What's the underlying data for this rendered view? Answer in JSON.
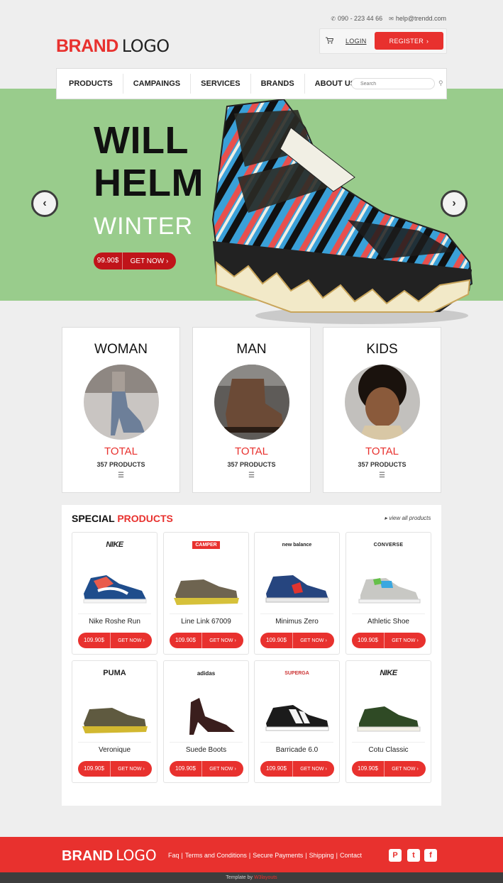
{
  "header": {
    "phone": "090 - 223 44 66",
    "email": "help@trendd.com",
    "logo_bold": "BRAND",
    "logo_light": "LOGO",
    "login": "LOGIN",
    "register": "REGISTER"
  },
  "nav": {
    "items": [
      "PRODUCTS",
      "CAMPAINGS",
      "SERVICES",
      "BRANDS",
      "ABOUT US"
    ],
    "search_placeholder": "Search"
  },
  "hero": {
    "title_line1": "WILL",
    "title_line2": "HELM",
    "subtitle": "WINTER",
    "price": "99.90$",
    "cta": "GET NOW",
    "prev_icon": "chevron-left-icon",
    "next_icon": "chevron-right-icon"
  },
  "categories": [
    {
      "title": "WOMAN",
      "total": "TOTAL",
      "count": "357 PRODUCTS"
    },
    {
      "title": "MAN",
      "total": "TOTAL",
      "count": "357 PRODUCTS"
    },
    {
      "title": "KIDS",
      "total": "TOTAL",
      "count": "357 PRODUCTS"
    }
  ],
  "special": {
    "title_black": "SPECIAL",
    "title_red": "PRODUCTS",
    "view_all": "view all products",
    "products": [
      {
        "brand": "NIKE",
        "name": "Nike Roshe Run",
        "price": "109.90$",
        "cta": "GET NOW"
      },
      {
        "brand": "CAMPER",
        "name": "Line Link 67009",
        "price": "109.90$",
        "cta": "GET NOW"
      },
      {
        "brand": "new balance",
        "name": "Minimus Zero",
        "price": "109.90$",
        "cta": "GET NOW"
      },
      {
        "brand": "CONVERSE",
        "name": "Athletic Shoe",
        "price": "109.90$",
        "cta": "GET NOW"
      },
      {
        "brand": "PUMA",
        "name": "Veronique",
        "price": "109.90$",
        "cta": "GET NOW"
      },
      {
        "brand": "adidas",
        "name": "Suede Boots",
        "price": "109.90$",
        "cta": "GET NOW"
      },
      {
        "brand": "SUPERGA",
        "name": "Barricade 6.0",
        "price": "109.90$",
        "cta": "GET NOW"
      },
      {
        "brand": "NIKE",
        "name": "Cotu Classic",
        "price": "109.90$",
        "cta": "GET NOW"
      }
    ]
  },
  "footer": {
    "logo_bold": "BRAND",
    "logo_light": "LOGO",
    "links": [
      "Faq",
      "Terms and Conditions",
      "Secure Payments",
      "Shipping",
      "Contact"
    ],
    "social": [
      "P",
      "t",
      "f"
    ],
    "credit_prefix": "Template by",
    "credit_name": "W3layouts"
  },
  "colors": {
    "accent": "#e8312e",
    "hero_bg": "#99cc8c",
    "dark_red": "#c0141a"
  }
}
